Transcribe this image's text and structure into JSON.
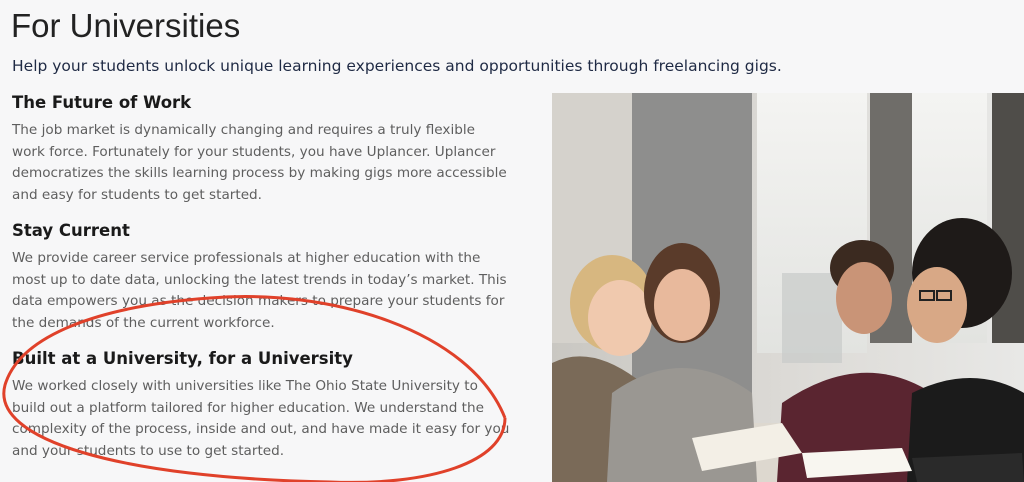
{
  "header": {
    "title": "For Universities",
    "intro": "Help your students unlock unique learning experiences and opportunities through freelancing gigs."
  },
  "sections": [
    {
      "heading": "The Future of Work",
      "body": "The job market is dynamically changing and requires a truly flexible work force. Fortunately for your students, you have Uplancer. Uplancer democratizes the skills learning process by making gigs more accessible and easy for students to get started."
    },
    {
      "heading": "Stay Current",
      "body": "We provide career service professionals at higher education with the most up to date data, unlocking the latest trends in today’s market. This data empowers you as the decision makers to prepare your students for the demands of the current workforce."
    },
    {
      "heading": "Built at a University, for a University",
      "body": "We worked closely with universities like The Ohio State University to build out a platform tailored for higher education. We understand the complexity of the process, inside and out, and have made it easy for you and your students to use to get started."
    }
  ],
  "image": {
    "subject": "students-studying-photo"
  },
  "annotation": {
    "color": "#e0412a"
  }
}
